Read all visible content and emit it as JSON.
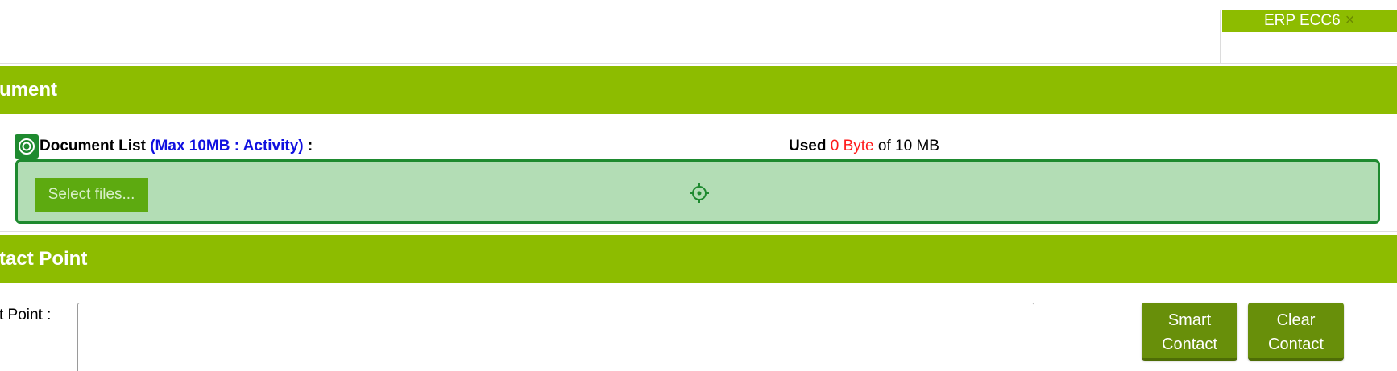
{
  "tab": {
    "label": "ERP ECC6",
    "close_symbol": "×"
  },
  "document_section": {
    "title": "ument",
    "list_label": "Document List",
    "max_info": "(Max 10MB : Activity)",
    "colon": ":",
    "usage": {
      "label": "Used",
      "value": "0 Byte",
      "suffix": "of 10 MB"
    },
    "select_button_label": "Select files..."
  },
  "contact_section": {
    "title": "tact Point",
    "field_label": "t Point :",
    "field_value": "",
    "smart_button": {
      "line1": "Smart",
      "line2": "Contact"
    },
    "clear_button": {
      "line1": "Clear",
      "line2": "Contact"
    }
  },
  "colors": {
    "band": "#8dbc00",
    "dropzone_bg": "#b3ddb5",
    "dropzone_border": "#1e8a2f",
    "button_dark": "#688f0a",
    "used_value": "#ff1a1a",
    "max_info": "#1010e0"
  },
  "icons": {
    "doc_list": "target-circle-icon",
    "dropzone": "crosshair-target-icon",
    "tab_close": "close-icon"
  }
}
